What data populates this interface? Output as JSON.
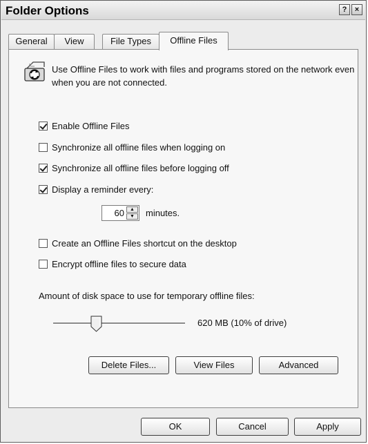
{
  "window": {
    "title": "Folder Options"
  },
  "titlebar": {
    "help_glyph": "?",
    "close_glyph": "×"
  },
  "tabs": [
    {
      "label": "General",
      "active": false
    },
    {
      "label": "View",
      "active": false
    },
    {
      "label": "File Types",
      "active": false
    },
    {
      "label": "Offline Files",
      "active": true
    }
  ],
  "intro": {
    "icon": "offline-files-sync-icon",
    "text": "Use Offline Files to work with files and programs stored on the network even when you are not connected."
  },
  "options": [
    {
      "label": "Enable Offline Files",
      "checked": true
    },
    {
      "label": "Synchronize all offline files when logging on",
      "checked": false
    },
    {
      "label": "Synchronize all offline files before logging off",
      "checked": true
    },
    {
      "label": "Display a reminder every:",
      "checked": true
    },
    {
      "label": "Create an Offline Files shortcut on the desktop",
      "checked": false
    },
    {
      "label": "Encrypt offline files to secure data",
      "checked": false
    }
  ],
  "reminder": {
    "value": "60",
    "unit_label": "minutes."
  },
  "disk": {
    "label": "Amount of disk space to use for temporary offline files:",
    "value_text": "620 MB (10% of drive)",
    "fraction": 0.1
  },
  "action_buttons": {
    "delete": "Delete Files...",
    "view": "View Files",
    "advanced": "Advanced"
  },
  "dialog_buttons": {
    "ok": "OK",
    "cancel": "Cancel",
    "apply": "Apply"
  }
}
